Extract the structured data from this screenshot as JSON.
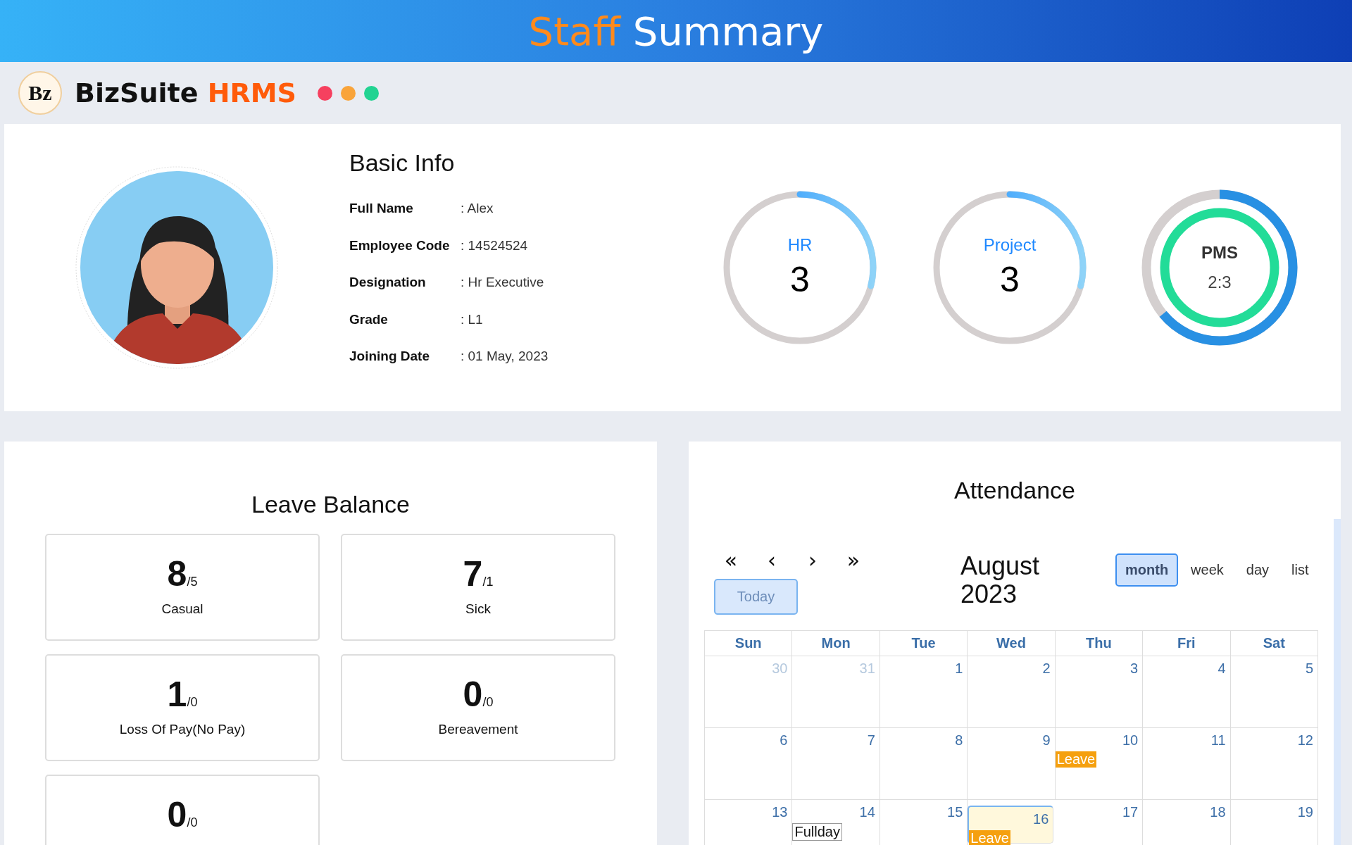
{
  "header": {
    "title_accent": "Staff",
    "title_rest": "Summary"
  },
  "brand": {
    "logo_text": "Bz",
    "name": "BizSuite",
    "name_accent": "HRMS",
    "dots": [
      {
        "color": "#f6405f"
      },
      {
        "color": "#f9a43a"
      },
      {
        "color": "#22d392"
      }
    ]
  },
  "basic_info": {
    "title": "Basic Info",
    "rows": [
      {
        "label": "Full Name",
        "value": ": Alex"
      },
      {
        "label": "Employee Code",
        "value": ": 14524524"
      },
      {
        "label": "Designation",
        "value": ": Hr Executive"
      },
      {
        "label": "Grade",
        "value": ": L1"
      },
      {
        "label": "Joining Date",
        "value": ": 01 May, 2023"
      }
    ]
  },
  "rings": [
    {
      "kind": "gauge",
      "label": "HR",
      "value": "3",
      "level": 0.29
    },
    {
      "kind": "gauge",
      "label": "Project",
      "value": "3",
      "level": 0.29
    },
    {
      "kind": "double",
      "label": "PMS",
      "value": "2:3",
      "level": 0.64
    }
  ],
  "leave_balance": {
    "title": "Leave Balance",
    "items": [
      {
        "value": "8",
        "total": "/5",
        "label": "Casual"
      },
      {
        "value": "7",
        "total": "/1",
        "label": "Sick"
      },
      {
        "value": "1",
        "total": "/0",
        "label": "Loss Of Pay(No Pay)"
      },
      {
        "value": "0",
        "total": "/0",
        "label": "Bereavement"
      },
      {
        "value": "0",
        "total": "/0"
      }
    ]
  },
  "attendance": {
    "title": "Attendance",
    "nav": [
      "«",
      "‹",
      "›",
      "»"
    ],
    "today_button": "Today",
    "month_title": "August 2023",
    "views": [
      {
        "label": "month",
        "selected": true
      },
      {
        "label": "week",
        "selected": false
      },
      {
        "label": "day",
        "selected": false
      },
      {
        "label": "list",
        "selected": false
      }
    ],
    "weekdays": [
      "Sun",
      "Mon",
      "Tue",
      "Wed",
      "Thu",
      "Fri",
      "Sat"
    ],
    "weeks": [
      [
        {
          "day": "30",
          "muted": true,
          "today": false
        },
        {
          "day": "31",
          "muted": true,
          "today": false
        },
        {
          "day": "1",
          "muted": false,
          "today": false
        },
        {
          "day": "2",
          "muted": false,
          "today": false
        },
        {
          "day": "3",
          "muted": false,
          "today": false
        },
        {
          "day": "4",
          "muted": false,
          "today": false
        },
        {
          "day": "5",
          "muted": false,
          "today": false
        }
      ],
      [
        {
          "day": "6",
          "muted": false,
          "today": false
        },
        {
          "day": "7",
          "muted": false,
          "today": false
        },
        {
          "day": "8",
          "muted": false,
          "today": false
        },
        {
          "day": "9",
          "muted": false,
          "today": false
        },
        {
          "day": "10",
          "muted": false,
          "today": false,
          "events": [
            {
              "kind": "leave",
              "label": "Leave"
            }
          ]
        },
        {
          "day": "11",
          "muted": false,
          "today": false
        },
        {
          "day": "12",
          "muted": false,
          "today": false
        }
      ],
      [
        {
          "day": "13",
          "muted": false,
          "today": false
        },
        {
          "day": "14",
          "muted": false,
          "today": false,
          "events": [
            {
              "kind": "fullday",
              "label": "Fullday"
            }
          ]
        },
        {
          "day": "15",
          "muted": false,
          "today": false
        },
        {
          "day": "16",
          "muted": false,
          "today": true,
          "events": [
            {
              "kind": "leave",
              "label": "Leave"
            }
          ]
        },
        {
          "day": "17",
          "muted": false,
          "today": false
        },
        {
          "day": "18",
          "muted": false,
          "today": false
        },
        {
          "day": "19",
          "muted": false,
          "today": false
        }
      ]
    ]
  }
}
